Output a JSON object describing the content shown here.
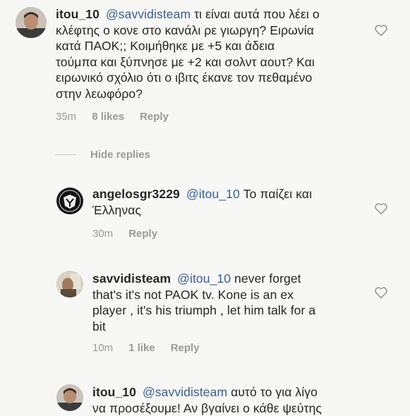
{
  "comments": [
    {
      "username": "itou_10",
      "mention": "@savvidisteam",
      "lines": [
        " τι είναι αυτά που λέει ο",
        "κλέφτης ο κονε στο κανάλι ρε γιωργη? Ειρωνία",
        "κατά ΠΑΟΚ;; Κοιμήθηκε με +5 και άδεια",
        "τούμπα και ξύπνησε με +2 και σολντ αουτ? Και",
        "ειρωνικό σχόλιο ότι ο ιβιτς έκανε τον πεθαμένο",
        "στην λεωφόρο?"
      ],
      "time": "35m",
      "likes": "8 likes",
      "reply": "Reply"
    },
    {
      "username": "angelosgr3229",
      "mention": "@itou_10",
      "lines": [
        " Το παίζει και",
        "Έλληνας"
      ],
      "time": "30m",
      "likes": "",
      "reply": "Reply"
    },
    {
      "username": "savvidisteam",
      "mention": "@itou_10",
      "lines": [
        " never forget",
        "that's it's not PAOK tv. Kone is an ex",
        "player ,  it's his triumph , let him talk for a",
        "bit"
      ],
      "time": "10m",
      "likes": "1 like",
      "reply": "Reply"
    },
    {
      "username": "itou_10",
      "mention": "@savvidisteam",
      "lines": [
        " αυτό το για λίγο",
        "να προσέξουμε! Αν βγαίνει ο κάθε ψεύτης"
      ],
      "time": "",
      "likes": "",
      "reply": ""
    }
  ],
  "hide_replies": "Hide replies",
  "colors": {
    "text": "#262626",
    "mention": "#3a5f8f",
    "meta": "#9a9a9a",
    "background": "#f7f7f5"
  },
  "icons": {
    "like": "heart-icon"
  }
}
